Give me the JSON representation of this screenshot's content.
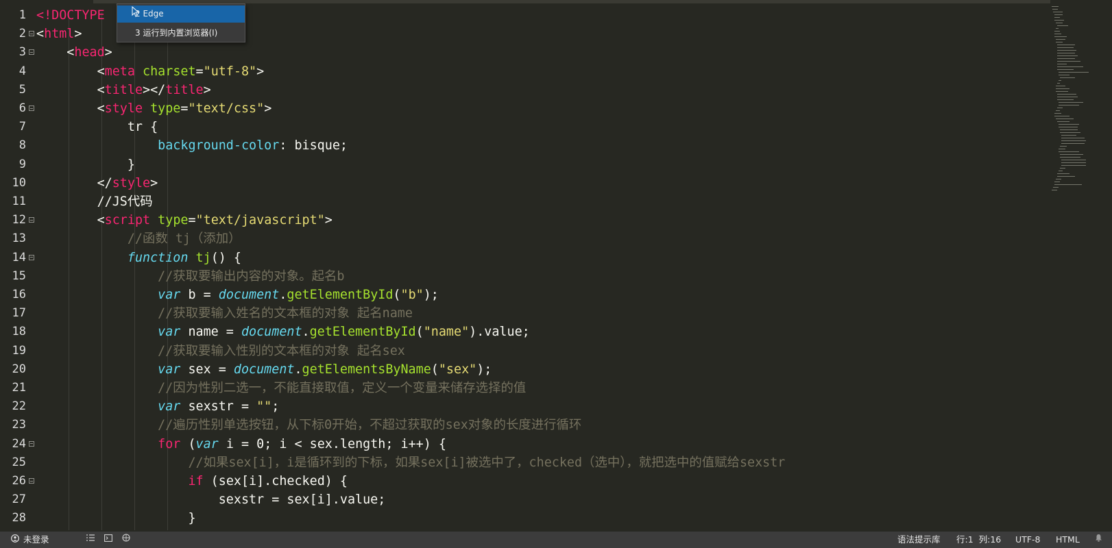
{
  "editor": {
    "lines": [
      {
        "n": "1",
        "fold": false,
        "segs": [
          [
            "tag",
            "<!DOCTYPE"
          ]
        ]
      },
      {
        "n": "2",
        "fold": true,
        "segs": [
          [
            "",
            "<"
          ],
          [
            "tag",
            "html"
          ],
          [
            "",
            ">"
          ]
        ]
      },
      {
        "n": "3",
        "fold": true,
        "segs": [
          [
            "",
            "    <"
          ],
          [
            "tag",
            "head"
          ],
          [
            "",
            ">"
          ]
        ]
      },
      {
        "n": "4",
        "fold": false,
        "segs": [
          [
            "",
            "        <"
          ],
          [
            "tag",
            "meta "
          ],
          [
            "attr",
            "charset"
          ],
          [
            "",
            "="
          ],
          [
            "str",
            "\"utf-8\""
          ],
          [
            "",
            ">"
          ]
        ]
      },
      {
        "n": "5",
        "fold": false,
        "segs": [
          [
            "",
            "        <"
          ],
          [
            "tag",
            "title"
          ],
          [
            "",
            "></"
          ],
          [
            "tag",
            "title"
          ],
          [
            "",
            ">"
          ]
        ]
      },
      {
        "n": "6",
        "fold": true,
        "segs": [
          [
            "",
            "        <"
          ],
          [
            "tag",
            "style "
          ],
          [
            "attr",
            "type"
          ],
          [
            "",
            "="
          ],
          [
            "str",
            "\"text/css\""
          ],
          [
            "",
            ">"
          ]
        ]
      },
      {
        "n": "7",
        "fold": false,
        "segs": [
          [
            "",
            "            tr {"
          ]
        ]
      },
      {
        "n": "8",
        "fold": false,
        "segs": [
          [
            "",
            "                "
          ],
          [
            "prop",
            "background-color"
          ],
          [
            "",
            ": bisque;"
          ]
        ]
      },
      {
        "n": "9",
        "fold": false,
        "segs": [
          [
            "",
            "            }"
          ]
        ]
      },
      {
        "n": "10",
        "fold": false,
        "segs": [
          [
            "",
            "        </"
          ],
          [
            "tag",
            "style"
          ],
          [
            "",
            ">"
          ]
        ]
      },
      {
        "n": "11",
        "fold": false,
        "segs": [
          [
            "",
            "        //JS代码"
          ]
        ]
      },
      {
        "n": "12",
        "fold": true,
        "segs": [
          [
            "",
            "        <"
          ],
          [
            "tag",
            "script "
          ],
          [
            "attr",
            "type"
          ],
          [
            "",
            "="
          ],
          [
            "str",
            "\"text/javascript\""
          ],
          [
            "",
            ">"
          ]
        ]
      },
      {
        "n": "13",
        "fold": false,
        "segs": [
          [
            "cmt",
            "            //函数 tj（添加）"
          ]
        ]
      },
      {
        "n": "14",
        "fold": true,
        "segs": [
          [
            "",
            "            "
          ],
          [
            "kw",
            "function "
          ],
          [
            "fn",
            "tj"
          ],
          [
            "",
            "() {"
          ]
        ]
      },
      {
        "n": "15",
        "fold": false,
        "segs": [
          [
            "cmt",
            "                //获取要输出内容的对象。起名b"
          ]
        ]
      },
      {
        "n": "16",
        "fold": false,
        "segs": [
          [
            "",
            "                "
          ],
          [
            "kw",
            "var"
          ],
          [
            "",
            " b = "
          ],
          [
            "obj",
            "document"
          ],
          [
            "",
            "."
          ],
          [
            "fn",
            "getElementById"
          ],
          [
            "",
            "("
          ],
          [
            "str",
            "\"b\""
          ],
          [
            "",
            ");"
          ]
        ]
      },
      {
        "n": "17",
        "fold": false,
        "segs": [
          [
            "cmt",
            "                //获取要输入姓名的文本框的对象 起名name"
          ]
        ]
      },
      {
        "n": "18",
        "fold": false,
        "segs": [
          [
            "",
            "                "
          ],
          [
            "kw",
            "var"
          ],
          [
            "",
            " name = "
          ],
          [
            "obj",
            "document"
          ],
          [
            "",
            "."
          ],
          [
            "fn",
            "getElementById"
          ],
          [
            "",
            "("
          ],
          [
            "str",
            "\"name\""
          ],
          [
            "",
            ").value;"
          ]
        ]
      },
      {
        "n": "19",
        "fold": false,
        "segs": [
          [
            "cmt",
            "                //获取要输入性别的文本框的对象 起名sex"
          ]
        ]
      },
      {
        "n": "20",
        "fold": false,
        "segs": [
          [
            "",
            "                "
          ],
          [
            "kw",
            "var"
          ],
          [
            "",
            " sex = "
          ],
          [
            "obj",
            "document"
          ],
          [
            "",
            "."
          ],
          [
            "fn",
            "getElementsByName"
          ],
          [
            "",
            "("
          ],
          [
            "str",
            "\"sex\""
          ],
          [
            "",
            ");"
          ]
        ]
      },
      {
        "n": "21",
        "fold": false,
        "segs": [
          [
            "cmt",
            "                //因为性别二选一，不能直接取值，定义一个变量来储存选择的值"
          ]
        ]
      },
      {
        "n": "22",
        "fold": false,
        "segs": [
          [
            "",
            "                "
          ],
          [
            "kw",
            "var"
          ],
          [
            "",
            " sexstr = "
          ],
          [
            "str",
            "\"\""
          ],
          [
            "",
            ";"
          ]
        ]
      },
      {
        "n": "23",
        "fold": false,
        "segs": [
          [
            "cmt",
            "                //遍历性别单选按钮，从下标0开始，不超过获取的sex对象的长度进行循环"
          ]
        ]
      },
      {
        "n": "24",
        "fold": true,
        "segs": [
          [
            "",
            "                "
          ],
          [
            "ctl",
            "for"
          ],
          [
            "",
            " ("
          ],
          [
            "kw",
            "var"
          ],
          [
            "",
            " i = "
          ],
          [
            "",
            "0"
          ],
          [
            "",
            "; i < sex.length; i++) {"
          ]
        ]
      },
      {
        "n": "25",
        "fold": false,
        "segs": [
          [
            "cmt",
            "                    //如果sex[i]，i是循环到的下标，如果sex[i]被选中了，checked（选中），就把选中的值赋给sexstr"
          ]
        ]
      },
      {
        "n": "26",
        "fold": true,
        "segs": [
          [
            "",
            "                    "
          ],
          [
            "ctl",
            "if"
          ],
          [
            "",
            " (sex[i].checked) {"
          ]
        ]
      },
      {
        "n": "27",
        "fold": false,
        "segs": [
          [
            "",
            "                        sexstr = sex[i].value;"
          ]
        ]
      },
      {
        "n": "28",
        "fold": false,
        "segs": [
          [
            "",
            "                    }"
          ]
        ]
      }
    ]
  },
  "popup": {
    "items": [
      "2 Edge",
      "3 运行到内置浏览器(I)"
    ]
  },
  "statusbar": {
    "login": "未登录",
    "hint_lib": "语法提示库",
    "position": "行:1  列:16",
    "encoding": "UTF-8",
    "language": "HTML"
  },
  "colors": {
    "background": "#272822",
    "tag": "#f92672",
    "attr": "#a6e22e",
    "string": "#e6db74",
    "keyword": "#66d9ef",
    "comment": "#75715e",
    "statusbar": "#3c3c3c",
    "popup_selected": "#1865a8"
  }
}
